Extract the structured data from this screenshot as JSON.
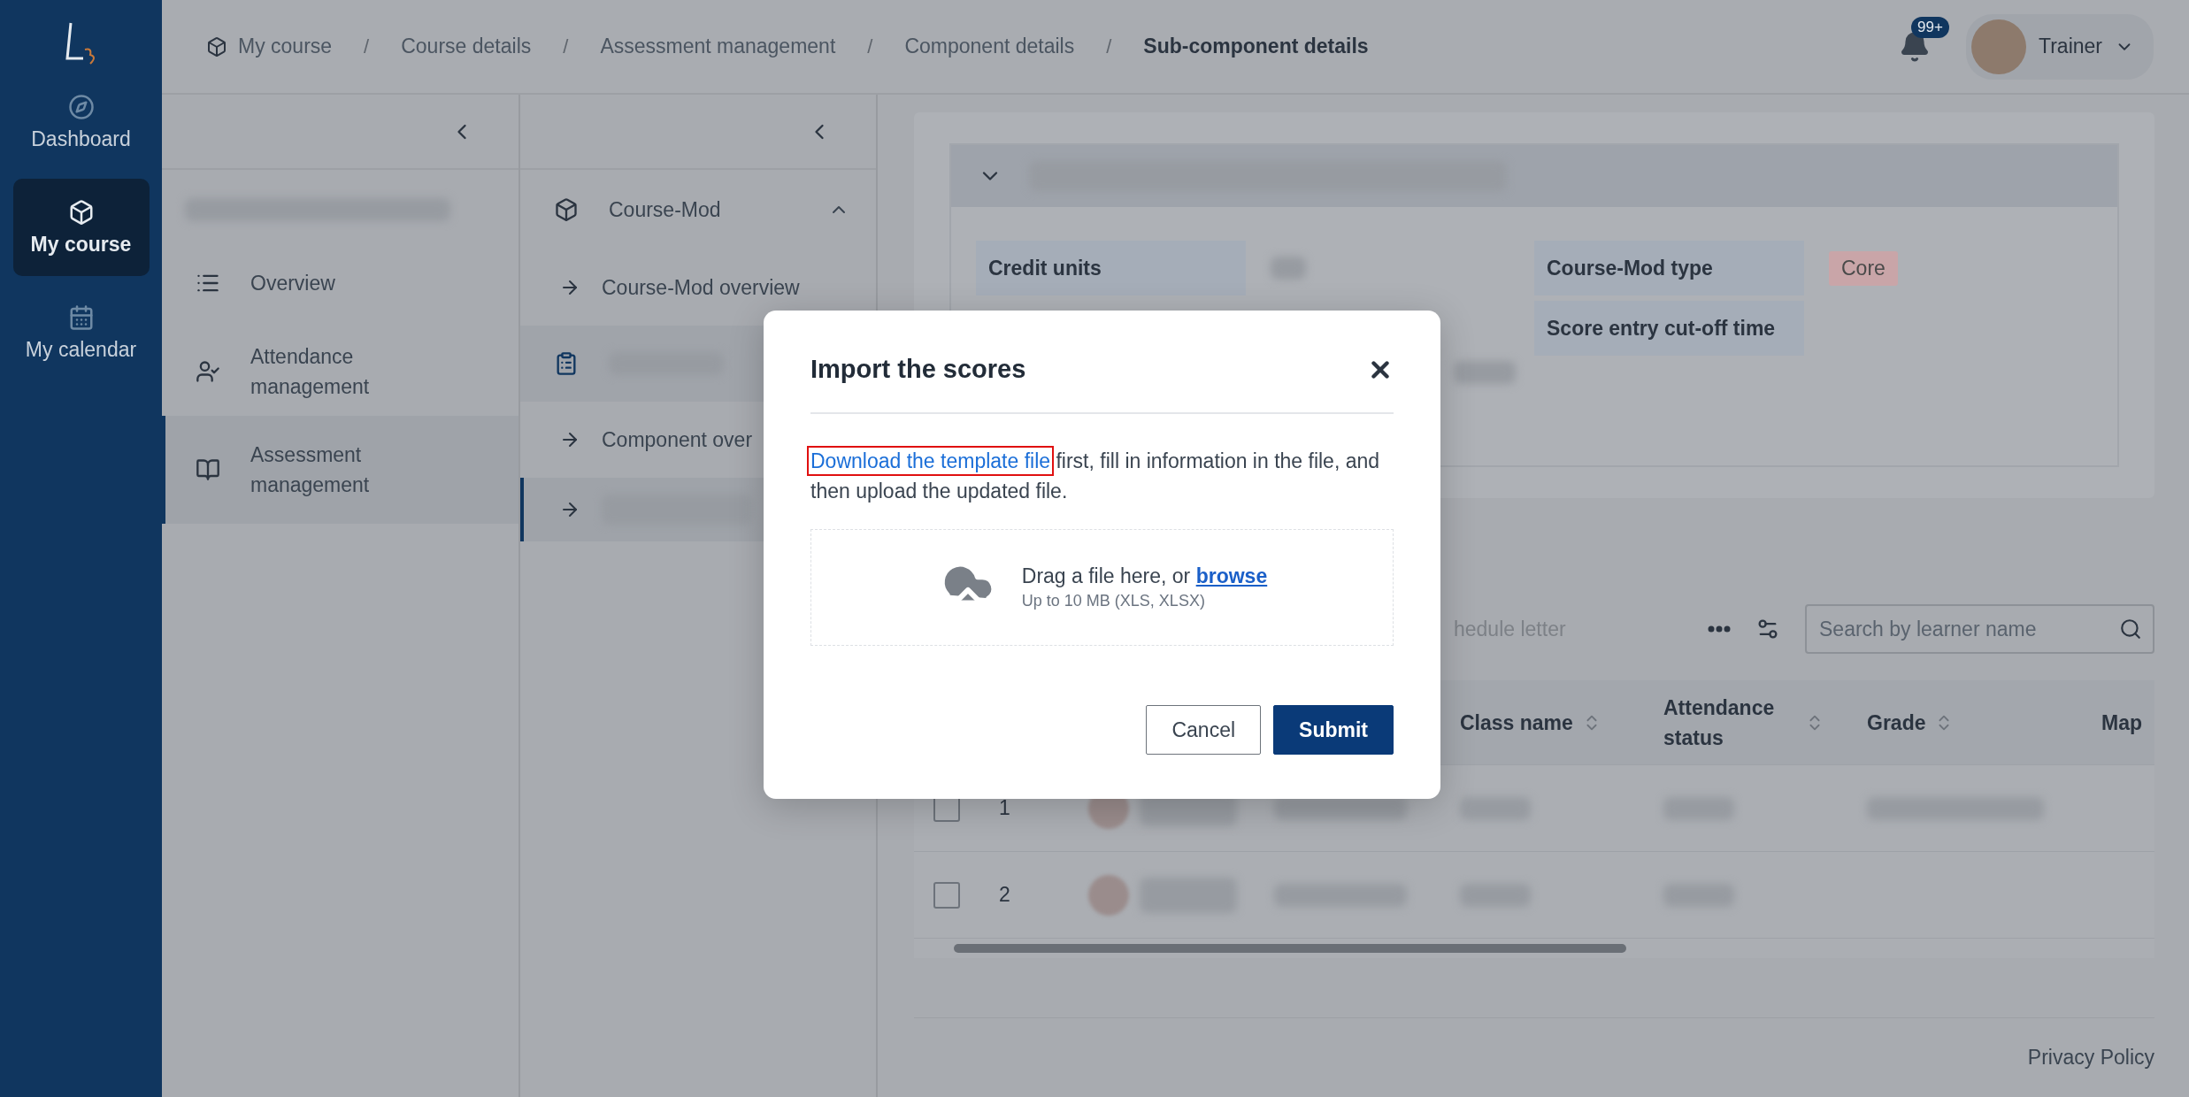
{
  "nav": {
    "items": [
      {
        "label": "Dashboard",
        "selected": false
      },
      {
        "label": "My course",
        "selected": true
      },
      {
        "label": "My calendar",
        "selected": false
      }
    ]
  },
  "breadcrumbs": {
    "separator": "/",
    "items": [
      {
        "label": "My course",
        "current": false
      },
      {
        "label": "Course details",
        "current": false
      },
      {
        "label": "Assessment management",
        "current": false
      },
      {
        "label": "Component details",
        "current": false
      },
      {
        "label": "Sub-component details",
        "current": true
      }
    ]
  },
  "notifications": {
    "badge": "99+"
  },
  "user": {
    "name": "Trainer"
  },
  "section_menu": {
    "items": [
      {
        "label": "Overview",
        "selected": false
      },
      {
        "label": "Attendance management",
        "selected": false
      },
      {
        "label": "Assessment management",
        "selected": true
      }
    ]
  },
  "module_menu": {
    "group": {
      "label": "Course-Mod",
      "expanded": true
    },
    "items": [
      {
        "kind": "link",
        "label": "Course-Mod overview",
        "selected": false
      },
      {
        "kind": "group",
        "selected": false
      },
      {
        "kind": "link",
        "label": "Component over",
        "selected": false
      },
      {
        "kind": "link",
        "selected": true
      }
    ]
  },
  "details": {
    "fields": [
      {
        "label": "Credit units"
      },
      {
        "label": "Course-Mod type",
        "tag": "Core"
      },
      {
        "label": "Score entry cut-off time"
      }
    ]
  },
  "toolbar": {
    "action": "hedule letter",
    "search": {
      "placeholder": "Search by learner name"
    }
  },
  "table": {
    "columns": [
      {
        "label": "Class name",
        "sortable": true
      },
      {
        "label": "Attendance status",
        "sortable": true
      },
      {
        "label": "Grade",
        "sortable": true
      },
      {
        "label": "Map",
        "sortable": false
      }
    ],
    "rows": [
      {
        "number": "1",
        "checked": false
      },
      {
        "number": "2",
        "checked": false
      }
    ]
  },
  "footer": {
    "link": "Privacy Policy"
  },
  "modal": {
    "title": "Import the scores",
    "link": "Download the template file",
    "text": " first, fill in information in the file, and then upload the updated file.",
    "drop_text": "Drag a file here, or ",
    "browse": "browse",
    "hint": "Up to 10 MB (XLS, XLSX)",
    "buttons": [
      {
        "label": "Cancel",
        "kind": "secondary"
      },
      {
        "label": "Submit",
        "kind": "primary"
      }
    ]
  }
}
